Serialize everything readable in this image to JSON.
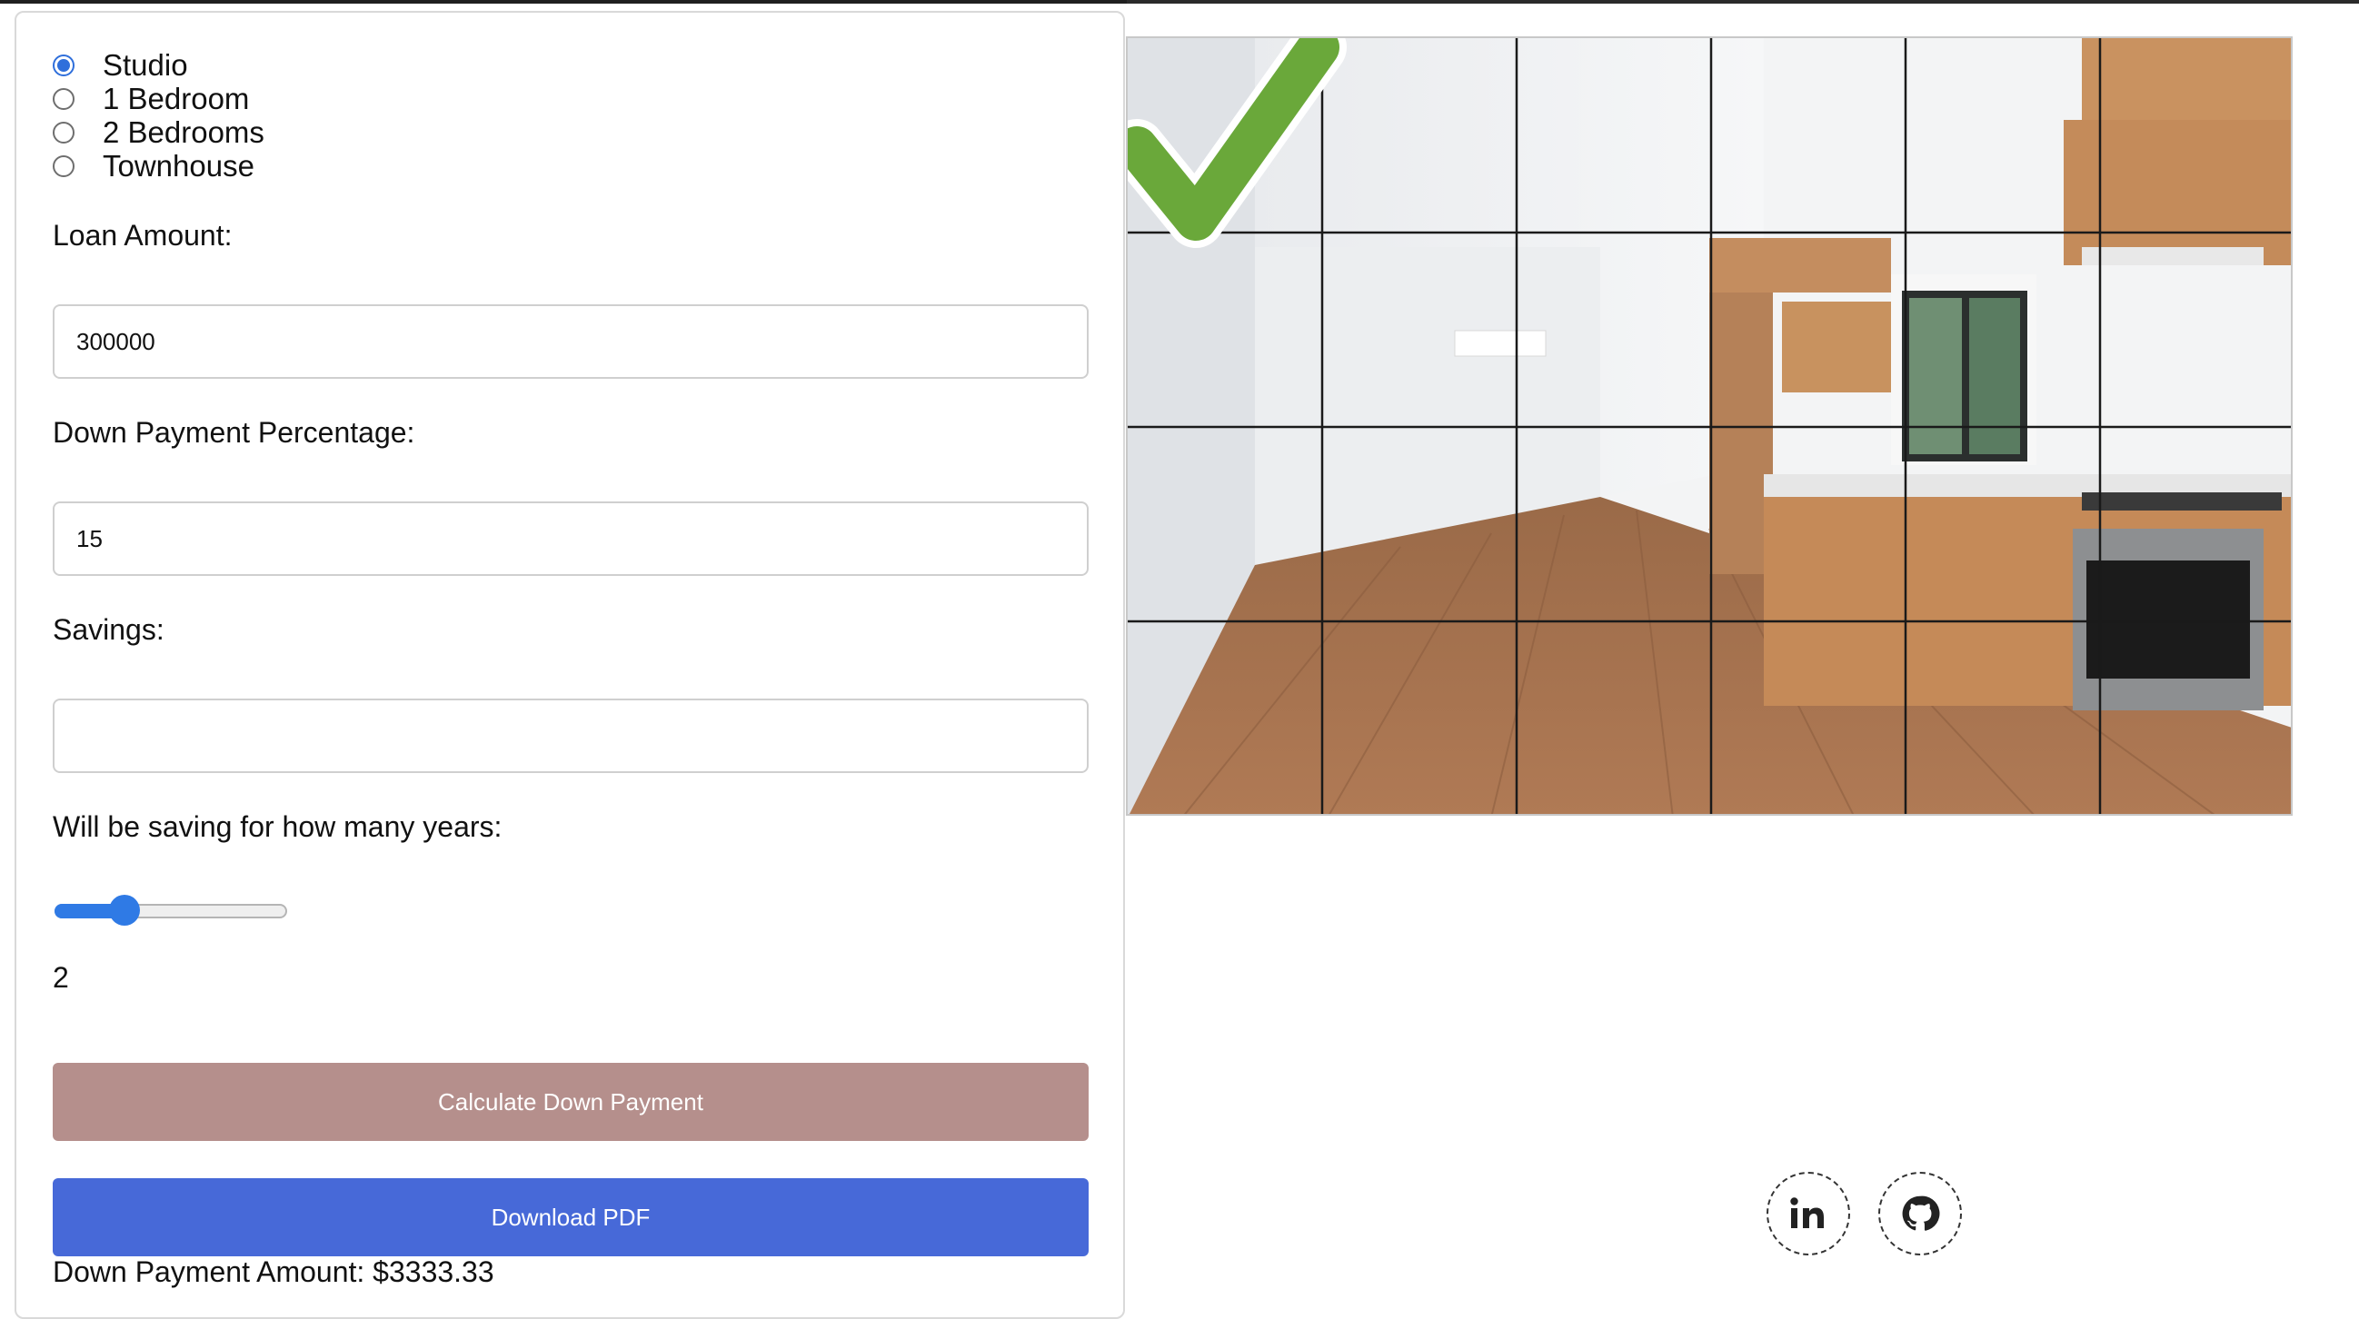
{
  "property_type": {
    "options": [
      {
        "label": "Studio",
        "checked": true
      },
      {
        "label": "1 Bedroom",
        "checked": false
      },
      {
        "label": "2 Bedrooms",
        "checked": false
      },
      {
        "label": "Townhouse",
        "checked": false
      }
    ]
  },
  "loan_amount": {
    "label": "Loan Amount:",
    "value": "300000"
  },
  "down_payment_pct": {
    "label": "Down Payment Percentage:",
    "value": "15"
  },
  "savings": {
    "label": "Savings:",
    "value": ""
  },
  "years": {
    "label": "Will be saving for how many years:",
    "value": "2",
    "slider_fraction": 0.27
  },
  "buttons": {
    "calculate": "Calculate Down Payment",
    "download": "Download PDF"
  },
  "result": {
    "text": "Down Payment Amount: $3333.33"
  },
  "image": {
    "overlay_icon": "green-checkmark-icon",
    "grid_rows": 4,
    "grid_cols": 6
  },
  "social": {
    "linkedin_icon": "linkedin-icon",
    "github_icon": "github-icon"
  },
  "colors": {
    "accent": "#2f7ae5",
    "calculate_button": "#b58f8c",
    "download_button": "#4769d8",
    "checkmark": "#6aa83a"
  }
}
